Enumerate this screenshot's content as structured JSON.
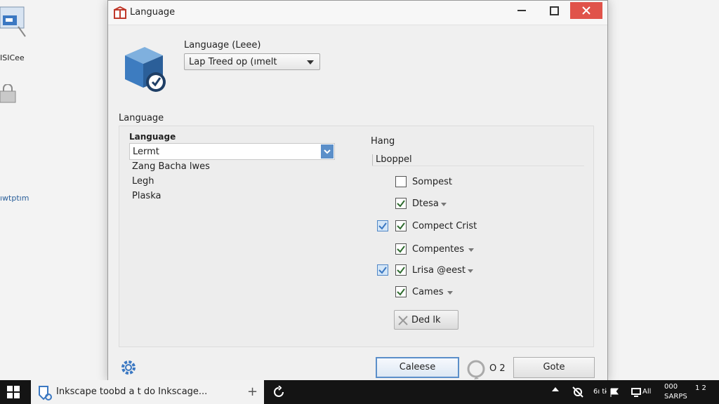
{
  "desktop": {
    "icon1_label": "ISICee",
    "icon3_label": "ıwtptım"
  },
  "dialog": {
    "title": "Language",
    "top_label": "Language (Leee)",
    "top_select_value": "Lap Treed op (ımelt",
    "section_label": "Language",
    "left": {
      "header": "Language",
      "combo_value": "Lermt",
      "items": [
        "Zang Bacha lwes",
        "Legh",
        "Plaska"
      ]
    },
    "right": {
      "header": "Hang",
      "subheader": "Lboppel",
      "options": [
        {
          "label": "Sompest",
          "checked": false,
          "blue": false,
          "dropdown": false
        },
        {
          "label": "Dtesa",
          "checked": true,
          "blue": false,
          "dropdown": true
        },
        {
          "label": "Compect Crist",
          "checked": true,
          "blue": true,
          "dropdown": false
        },
        {
          "label": "Compentes",
          "checked": true,
          "blue": false,
          "dropdown": true
        },
        {
          "label": "Lrisa @eest",
          "checked": true,
          "blue": true,
          "dropdown": true
        },
        {
          "label": "Cames",
          "checked": true,
          "blue": false,
          "dropdown": true
        }
      ],
      "small_button": "Ded lk"
    },
    "footer": {
      "primary_button": "Caleese",
      "spinner_text": "O 2",
      "secondary_button": "Gote"
    }
  },
  "taskbar": {
    "task_label": "Inkscape toobd a t do Inkscage...",
    "tray_text1": "6ı tɨ",
    "tray_text2": "All",
    "clock_line1": "000",
    "clock_line2": "SARPS",
    "notif": "1 2"
  },
  "colors": {
    "accent": "#5b8fc9",
    "close": "#e0534a",
    "taskbar": "#141414"
  }
}
